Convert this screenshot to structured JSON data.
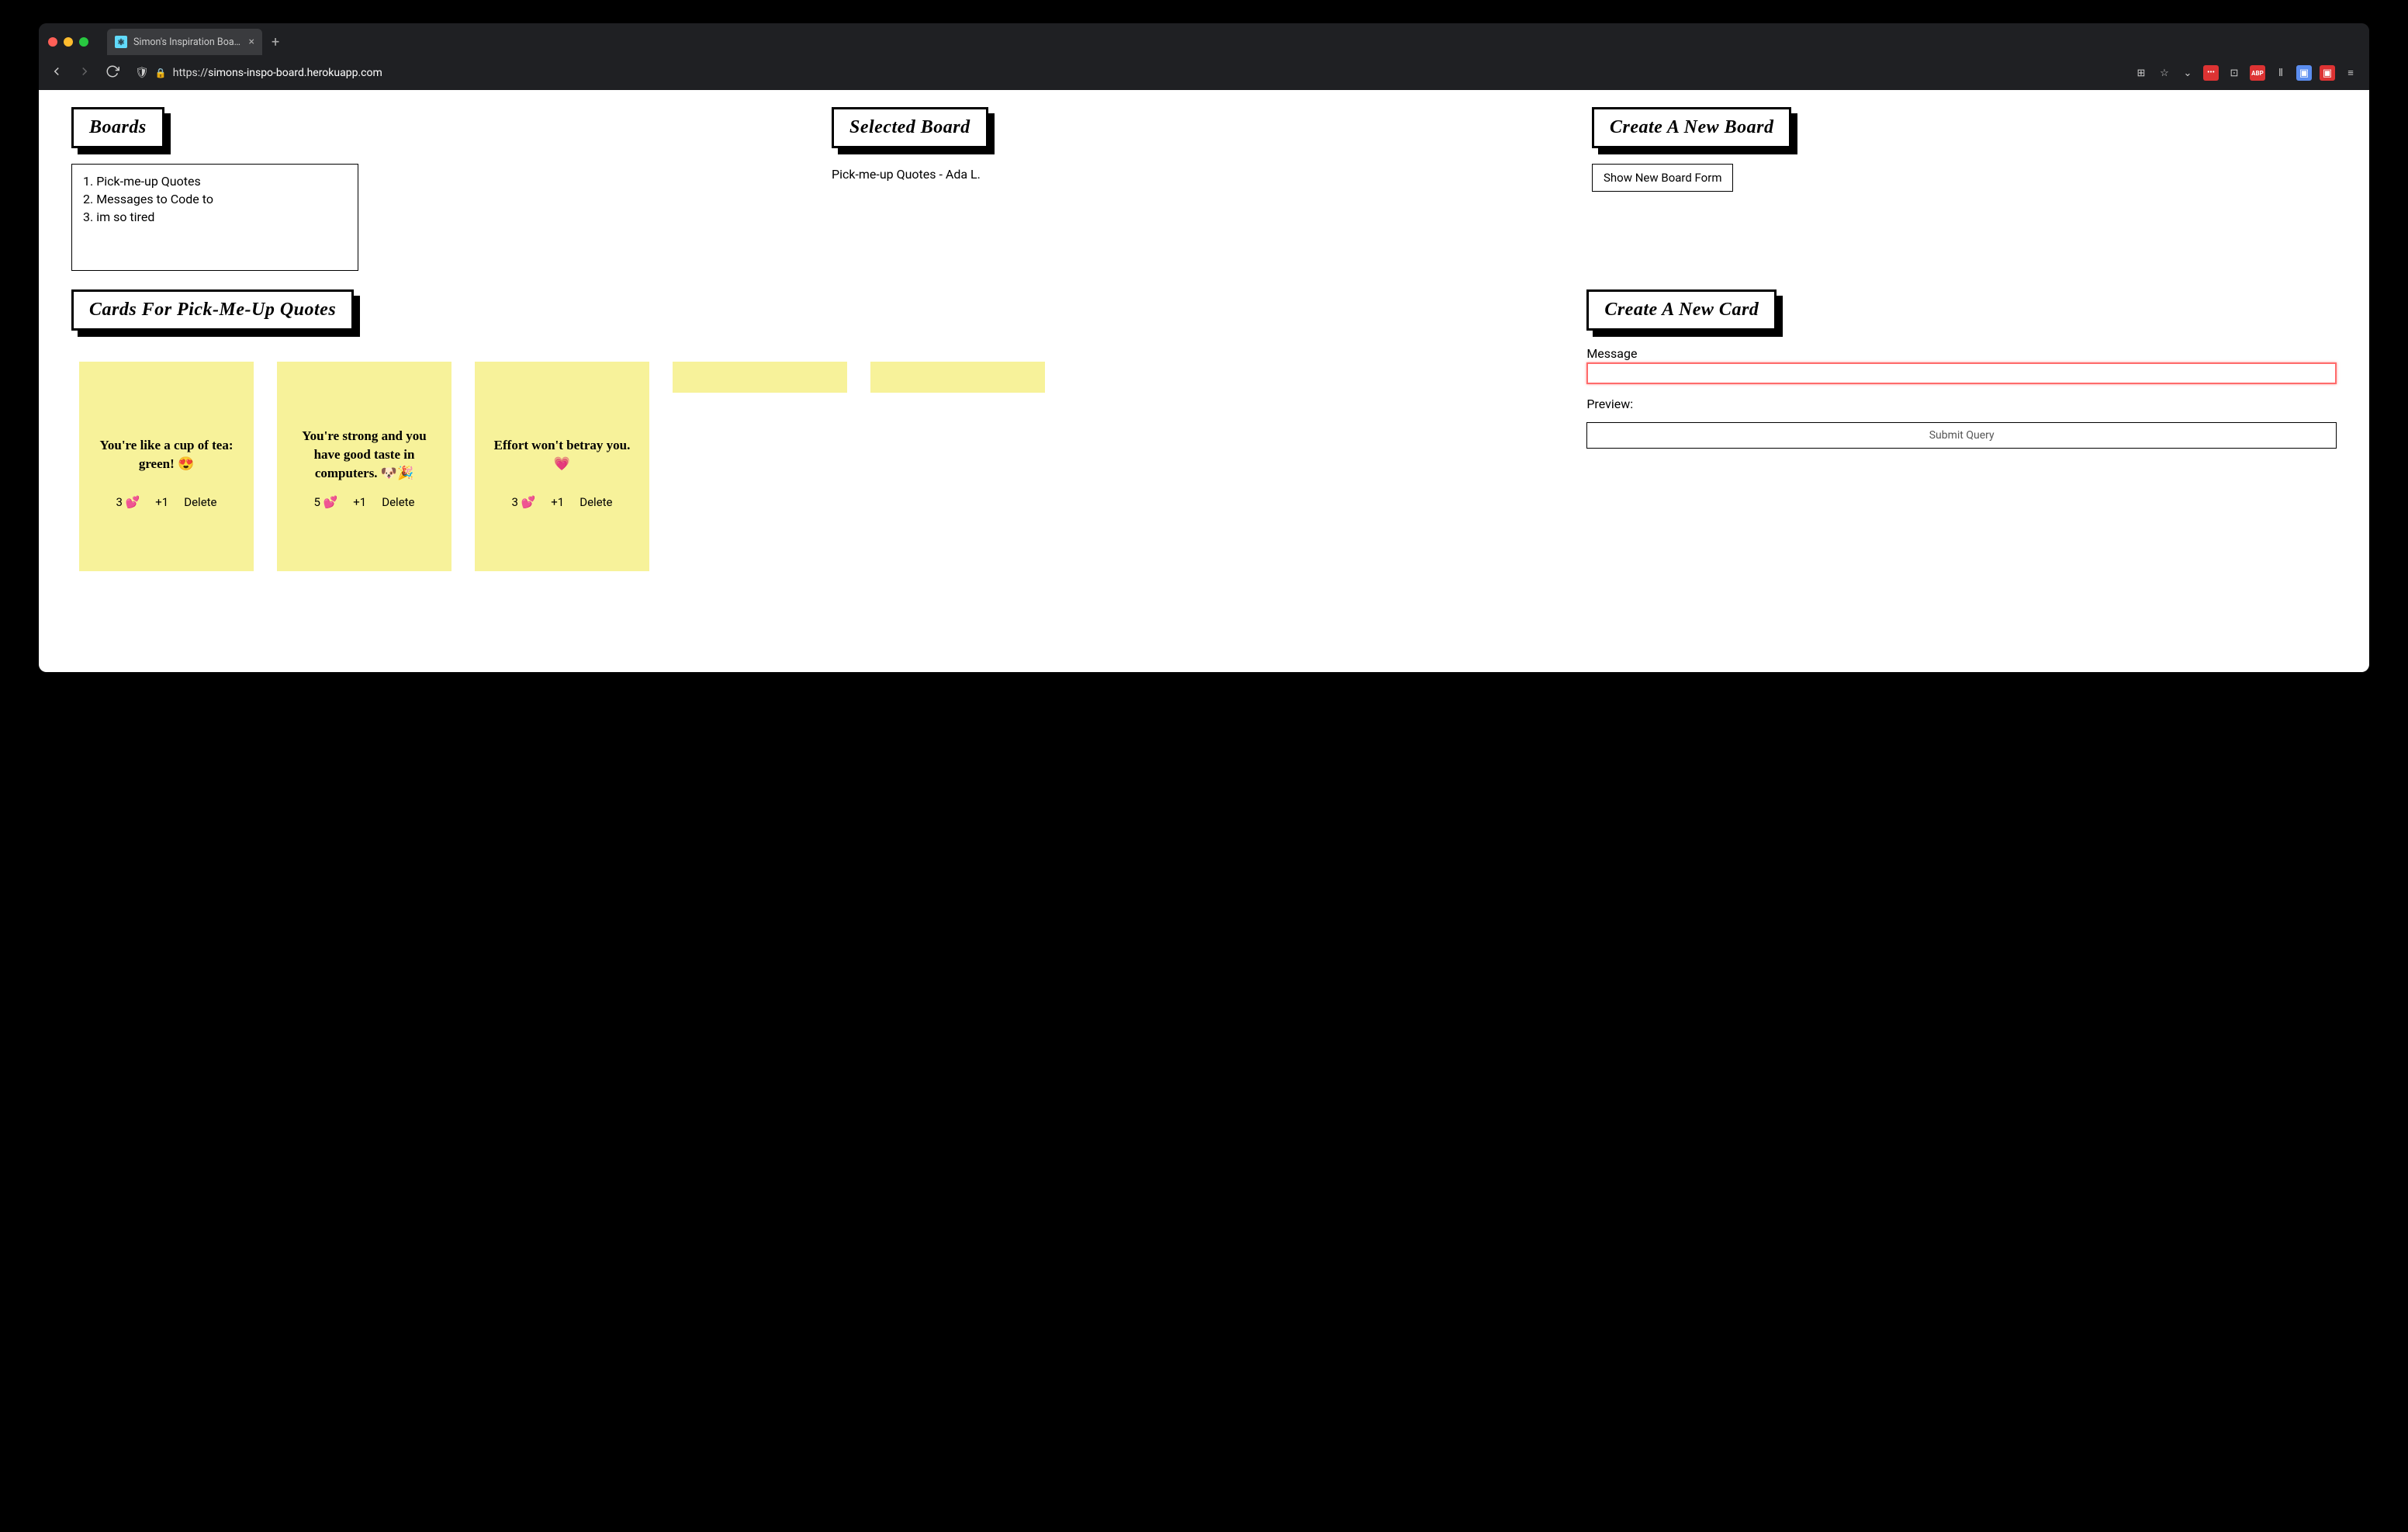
{
  "browser": {
    "tab_title": "Simon's Inspiration Board",
    "url_prefix": "https://",
    "url_domain": "simons-inspo-board.herokuapp.com"
  },
  "headers": {
    "boards": "Boards",
    "selected_board": "Selected Board",
    "create_board": "Create a New Board",
    "cards_for": "Cards for Pick-me-up Quotes",
    "create_card": "Create a New Card"
  },
  "boards": [
    "Pick-me-up Quotes",
    "Messages to Code to",
    "im so tired"
  ],
  "selected_board_text": "Pick-me-up Quotes - Ada L.",
  "buttons": {
    "show_new_board_form": "Show New Board Form",
    "submit_query": "Submit Query"
  },
  "cards": [
    {
      "message": "You're like a cup of tea: green! 😍",
      "likes": "3 💕",
      "plus_one": "+1",
      "delete": "Delete"
    },
    {
      "message": "You're strong and you have good taste in computers. 🐶🎉",
      "likes": "5 💕",
      "plus_one": "+1",
      "delete": "Delete"
    },
    {
      "message": "Effort won't betray you. 💗",
      "likes": "3 💕",
      "plus_one": "+1",
      "delete": "Delete"
    }
  ],
  "card_form": {
    "message_label": "Message",
    "preview_label": "Preview:",
    "message_value": ""
  }
}
